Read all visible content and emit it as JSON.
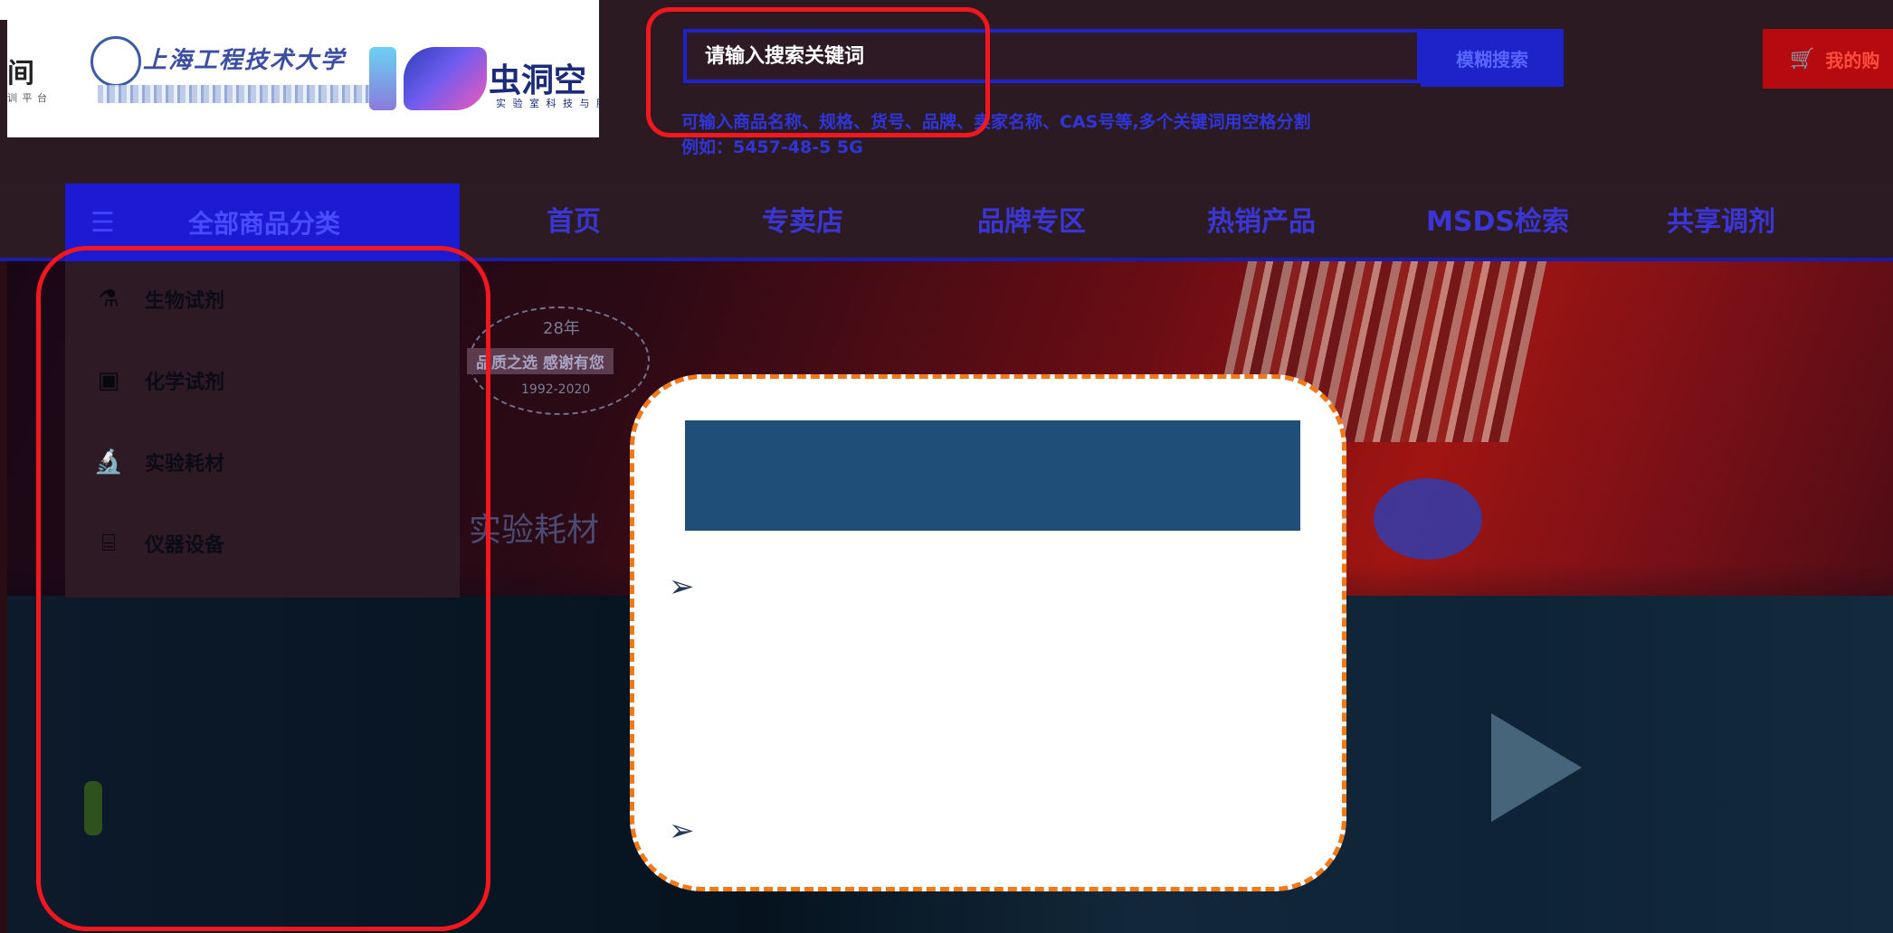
{
  "header": {
    "logo_left_text": "间",
    "logo_left_tiny": "训 平 台",
    "university_name": "上海工程技术大学",
    "lab_name": "虫洞空",
    "lab_tagline": "实 验 室 科 技 与 服 务"
  },
  "search": {
    "placeholder": "请输入搜索关键词",
    "button_label": "模糊搜索",
    "hint": "可输入商品名称、规格、货号、品牌、卖家名称、CAS号等,多个关键词用空格分割",
    "example": "例如：5457-48-5 5G"
  },
  "cart": {
    "label": "我的购",
    "icon": "cart-icon"
  },
  "nav": {
    "all_categories_label": "全部商品分类",
    "menu_icon": "hamburger-icon",
    "links": [
      "首页",
      "专卖店",
      "品牌专区",
      "热销产品",
      "MSDS检索",
      "共享调剂"
    ]
  },
  "categories": [
    {
      "label": "生物试剂",
      "icon": "flask-icon"
    },
    {
      "label": "化学试剂",
      "icon": "reagent-bottle-icon"
    },
    {
      "label": "实验耗材",
      "icon": "microscope-icon"
    },
    {
      "label": "仪器设备",
      "icon": "instrument-icon"
    }
  ],
  "hero": {
    "badge_years": "28年",
    "badge_slogan": "品质之选 感谢有您",
    "badge_range": "1992-2020",
    "subtitle": "实验耗材"
  },
  "colors": {
    "annotation_red": "#f2171e",
    "callout_border": "#f07a1a",
    "callout_header": "#1f4e79",
    "nav_accent": "#1c1ad2"
  }
}
